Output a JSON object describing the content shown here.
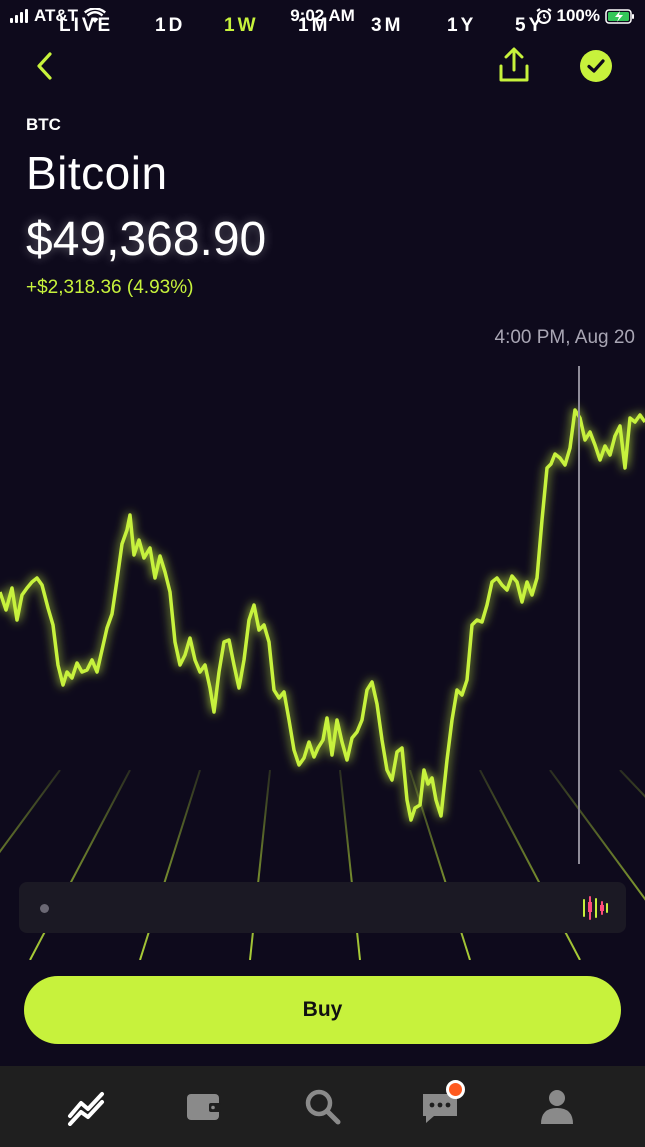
{
  "status_bar": {
    "carrier": "AT&T",
    "time": "9:02 AM",
    "battery": "100%"
  },
  "nav": {
    "back_icon": "chevron-left-icon",
    "share_icon": "share-icon",
    "watchlist_icon": "checkmark-circle-icon"
  },
  "asset": {
    "ticker": "BTC",
    "name": "Bitcoin",
    "price": "$49,368.90",
    "change": "+$2,318.36 (4.93%)"
  },
  "chart": {
    "hover_time": "4:00 PM, Aug 20",
    "line_color": "#c7f23c"
  },
  "range": {
    "items": [
      {
        "label": "LIVE"
      },
      {
        "label": "1D"
      },
      {
        "label": "1W",
        "active": true
      },
      {
        "label": "1M"
      },
      {
        "label": "3M"
      },
      {
        "label": "1Y"
      },
      {
        "label": "5Y"
      }
    ]
  },
  "actions": {
    "buy_label": "Buy"
  },
  "tabs": [
    {
      "name": "investing-icon"
    },
    {
      "name": "wallet-icon"
    },
    {
      "name": "search-icon"
    },
    {
      "name": "messages-icon"
    },
    {
      "name": "account-icon"
    }
  ],
  "colors": {
    "accent": "#c7f23c",
    "background": "#0e0a1c",
    "notification": "#ff5a1f"
  }
}
